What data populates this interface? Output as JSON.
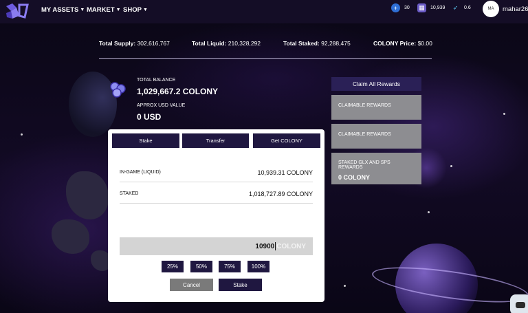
{
  "nav": {
    "items": [
      {
        "label": "MY ASSETS"
      },
      {
        "label": "MARKET"
      },
      {
        "label": "SHOP"
      }
    ],
    "stats": [
      {
        "icon": "plus-circle-icon",
        "value": "30",
        "color": "#2f6fd6"
      },
      {
        "icon": "cards-icon",
        "value": "10,939",
        "color": "#6b5cc7"
      },
      {
        "icon": "rocket-icon",
        "value": "0.6",
        "color": "#56b7e0"
      }
    ],
    "avatar_initials": "MA",
    "username": "mahar26"
  },
  "supply": {
    "total_supply_label": "Total Supply:",
    "total_supply_value": "302,616,767",
    "total_liquid_label": "Total Liquid:",
    "total_liquid_value": "210,328,292",
    "total_staked_label": "Total Staked:",
    "total_staked_value": "92,288,475",
    "price_label": "COLONY Price:",
    "price_value": "$0.00"
  },
  "balance": {
    "total_label": "TOTAL BALANCE",
    "total_value": "1,029,667.2 COLONY",
    "usd_label": "APPROX USD VALUE",
    "usd_value": "0 USD"
  },
  "rewards": {
    "claim_all_label": "Claim All Rewards",
    "cards": [
      {
        "label": "CLAIMABLE REWARDS",
        "value": ""
      },
      {
        "label": "CLAIMABLE REWARDS",
        "value": ""
      },
      {
        "label": "STAKED GLX AND SPS REWARDS",
        "value": "0 COLONY"
      }
    ]
  },
  "modal": {
    "tabs": [
      "Stake",
      "Transfer",
      "Get COLONY"
    ],
    "rows": [
      {
        "label": "IN-GAME (LIQUID)",
        "value": "10,939.31 COLONY"
      },
      {
        "label": "STAKED",
        "value": "1,018,727.89 COLONY"
      }
    ],
    "amount": {
      "value": "10900",
      "unit": "COLONY"
    },
    "percent_buttons": [
      "25%",
      "50%",
      "75%",
      "100%"
    ],
    "cancel_label": "Cancel",
    "stake_label": "Stake",
    "colors": {
      "dark_button": "#1f1740",
      "cancel_button": "#7a7a7a"
    }
  }
}
